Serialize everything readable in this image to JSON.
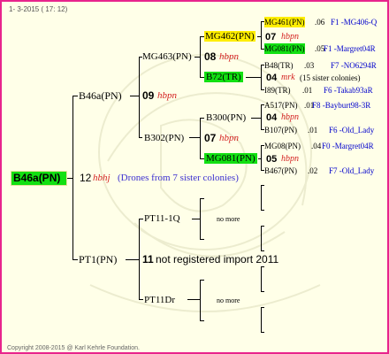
{
  "header": {
    "date_text": "1-  3-2015 ( 17: 12)"
  },
  "footer": {
    "copyright": "Copyright 2008-2015 @ Karl Kehrle Foundation."
  },
  "root": {
    "label": "B46a(PN)",
    "gen": "12",
    "hatch": "hbhj",
    "note": "(Drones from 7 sister colonies)"
  },
  "father": {
    "label": "B46a(PN)",
    "gen": "09",
    "hatch": "hbpn",
    "fa": {
      "label": "MG463(PN)",
      "gen": "08",
      "hatch": "hbpn",
      "fa": {
        "label": "MG462(PN)",
        "gen": "07",
        "hatch": "hbpn",
        "fa": {
          "label": "MG461(PN)",
          "year": ".06",
          "line": "F1 -MG406-Q"
        },
        "mo": {
          "label": "MG081(PN)",
          "year": ".05",
          "line": "F1 -Margret04R"
        }
      },
      "mo": {
        "label": "B72(TR)",
        "gen": "04",
        "hatch": "mrk",
        "note": "(15 sister colonies)",
        "fa": {
          "label": "B48(TR)",
          "year": ".03",
          "line": "F7 -NO6294R"
        },
        "mo": {
          "label": "I89(TR)",
          "year": ".01",
          "line": "F6 -Takab93aR"
        }
      }
    },
    "mo": {
      "label": "B302(PN)",
      "gen": "07",
      "hatch": "hbpn",
      "fa": {
        "label": "B300(PN)",
        "gen": "04",
        "hatch": "hbpn",
        "fa": {
          "label": "A517(PN)",
          "year": ".01",
          "line": "F8 -Bayburt98-3R"
        },
        "mo": {
          "label": "B107(PN)",
          "year": ".01",
          "line": "F6 -Old_Lady"
        }
      },
      "mo": {
        "label": "MG081(PN)",
        "gen": "05",
        "hatch": "hbpn",
        "fa": {
          "label": "MG08(PN)",
          "year": ".04",
          "line": "F0 -Margret04R"
        },
        "mo": {
          "label": "B467(PN)",
          "year": ".02",
          "line": "F7 -Old_Lady"
        }
      }
    }
  },
  "mother": {
    "label": "PT1(PN)",
    "gen": "11",
    "note": "not registered import 2011",
    "fa": {
      "label": "PT11-1Q",
      "more": "no more"
    },
    "mo": {
      "label": "PT11Dr",
      "more": "no more"
    }
  },
  "colors": {
    "border": "#e8248c",
    "background": "#ffffe8",
    "green": "#12e012",
    "yellow": "#ffee00",
    "hatch": "#d42222",
    "link": "#0000cc"
  }
}
